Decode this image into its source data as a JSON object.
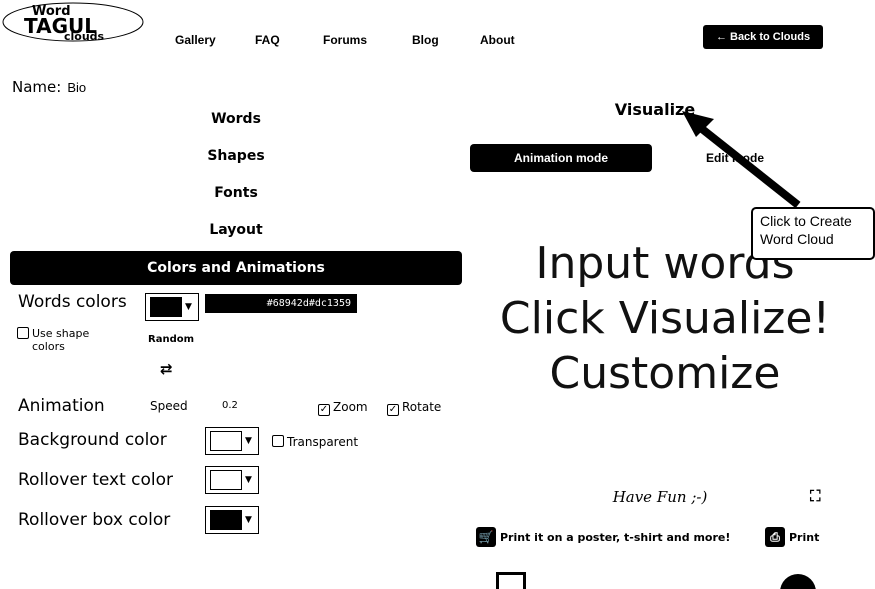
{
  "logo": {
    "line1": "Word",
    "line2": "TAGUL",
    "line3": "clouds"
  },
  "nav": {
    "items": [
      "Gallery",
      "FAQ",
      "Forums",
      "Blog",
      "About"
    ],
    "back_label": "← Back to Clouds"
  },
  "name": {
    "label": "Name:",
    "value": "Bio"
  },
  "menu": {
    "items": [
      "Words",
      "Shapes",
      "Fonts",
      "Layout"
    ]
  },
  "colors_panel": {
    "title": "Colors and Animations",
    "words_colors_label": "Words colors",
    "words_color_value": "#000000",
    "hex_value": "#68942d#dc1359",
    "use_shape_colors_label": "Use shape colors",
    "random_label": "Random",
    "animation_label": "Animation",
    "speed_label": "Speed",
    "speed_value": "0.2",
    "zoom_label": "Zoom",
    "rotate_label": "Rotate",
    "background_color_label": "Background color",
    "background_color_value": "#ffffff",
    "transparent_label": "Transparent",
    "rollover_text_label": "Rollover text color",
    "rollover_text_value": "#ffffff",
    "rollover_box_label": "Rollover box color",
    "rollover_box_value": "#000000"
  },
  "right": {
    "visualize_label": "Visualize",
    "animation_mode_label": "Animation mode",
    "edit_mode_label": "Edit mode",
    "canvas_lines": [
      "Input words",
      "Click Visualize!",
      "Customize"
    ],
    "callout_text": "Click to Create Word Cloud",
    "have_fun": "Have Fun ;-)",
    "print_poster_label": "Print it on a poster, t-shirt and more!",
    "print_label": "Print"
  }
}
